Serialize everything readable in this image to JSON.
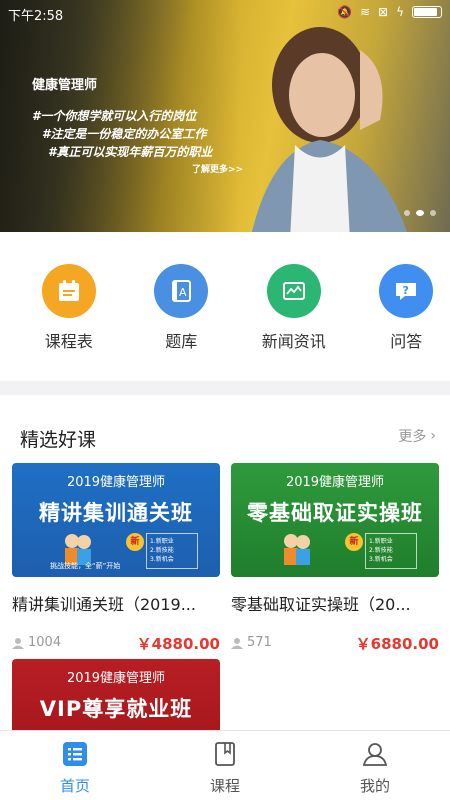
{
  "status_bar": {
    "time": "下午2:58"
  },
  "banner": {
    "title": "健康管理师",
    "lines": [
      "#一个你想学就可以入行的岗位",
      "#注定是一份稳定的办公室工作",
      "#真正可以实现年薪百万的职业"
    ],
    "more_link": "了解更多>>",
    "slide_count": 3,
    "active_slide": 2
  },
  "quick_nav": [
    {
      "label": "课程表",
      "icon": "calendar-icon",
      "color": "#f5a623"
    },
    {
      "label": "题库",
      "icon": "book-icon",
      "color": "#4a90e2"
    },
    {
      "label": "新闻资讯",
      "icon": "news-icon",
      "color": "#2bb673"
    },
    {
      "label": "问答",
      "icon": "question-icon",
      "color": "#3f8ef0"
    }
  ],
  "section": {
    "title": "精选好课",
    "more_label": "更多"
  },
  "courses": [
    {
      "thumb_sub": "2019健康管理师",
      "thumb_title": "精讲集训通关班",
      "thumb_theme": "blue",
      "title": "精讲集训通关班（2019...",
      "students": "1004",
      "price": "￥4880.00"
    },
    {
      "thumb_sub": "2019健康管理师",
      "thumb_title": "零基础取证实操班",
      "thumb_theme": "green",
      "title": "零基础取证实操班（20...",
      "students": "571",
      "price": "￥6880.00"
    },
    {
      "thumb_sub": "2019健康管理师",
      "thumb_title": "VIP尊享就业班",
      "thumb_theme": "red"
    }
  ],
  "thumb_extras": {
    "badge": "新",
    "box_lines": [
      "1.新职业",
      "2.新技能",
      "3.新机会"
    ],
    "slogan": "挑战技能，全“薪”开始"
  },
  "tabs": [
    {
      "label": "首页",
      "icon": "home-list-icon",
      "active": true
    },
    {
      "label": "课程",
      "icon": "course-book-icon",
      "active": false
    },
    {
      "label": "我的",
      "icon": "user-icon",
      "active": false
    }
  ],
  "colors": {
    "accent": "#2f8fe8",
    "price": "#e8372f"
  }
}
